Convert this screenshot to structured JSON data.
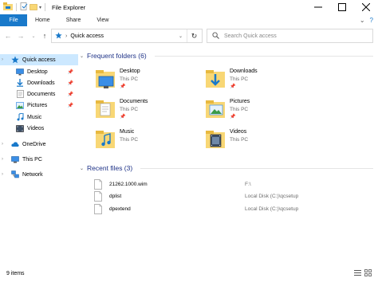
{
  "window": {
    "title": "File Explorer"
  },
  "ribbon": {
    "tabs": [
      "File",
      "Home",
      "Share",
      "View"
    ]
  },
  "address": {
    "path": "Quick access"
  },
  "search": {
    "placeholder": "Search Quick access"
  },
  "nav": {
    "items": [
      {
        "label": "Quick access",
        "icon": "star-icon",
        "pinned": false
      },
      {
        "label": "Desktop",
        "icon": "desktop-icon",
        "pinned": true
      },
      {
        "label": "Downloads",
        "icon": "downloads-icon",
        "pinned": true
      },
      {
        "label": "Documents",
        "icon": "documents-icon",
        "pinned": true
      },
      {
        "label": "Pictures",
        "icon": "pictures-icon",
        "pinned": true
      },
      {
        "label": "Music",
        "icon": "music-icon",
        "pinned": false
      },
      {
        "label": "Videos",
        "icon": "videos-icon",
        "pinned": false
      },
      {
        "label": "OneDrive",
        "icon": "cloud-icon",
        "pinned": false
      },
      {
        "label": "This PC",
        "icon": "pc-icon",
        "pinned": false
      },
      {
        "label": "Network",
        "icon": "network-icon",
        "pinned": false
      }
    ]
  },
  "frequent": {
    "heading": "Frequent folders (6)",
    "folders": [
      {
        "name": "Desktop",
        "location": "This PC",
        "pinned": true
      },
      {
        "name": "Downloads",
        "location": "This PC",
        "pinned": true
      },
      {
        "name": "Documents",
        "location": "This PC",
        "pinned": true
      },
      {
        "name": "Pictures",
        "location": "This PC",
        "pinned": true
      },
      {
        "name": "Music",
        "location": "This PC",
        "pinned": false
      },
      {
        "name": "Videos",
        "location": "This PC",
        "pinned": false
      }
    ]
  },
  "recent": {
    "heading": "Recent files (3)",
    "files": [
      {
        "name": "21262.1000.wim",
        "location": "F:\\"
      },
      {
        "name": "dplist",
        "location": "Local Disk (C:)\\qcsetup"
      },
      {
        "name": "dpextend",
        "location": "Local Disk (C:)\\qcsetup"
      }
    ]
  },
  "status": {
    "text": "9 items"
  },
  "colors": {
    "accent": "#1979ca",
    "selection": "#cce8ff",
    "heading": "#1e3287",
    "folder": "#f8d775"
  }
}
